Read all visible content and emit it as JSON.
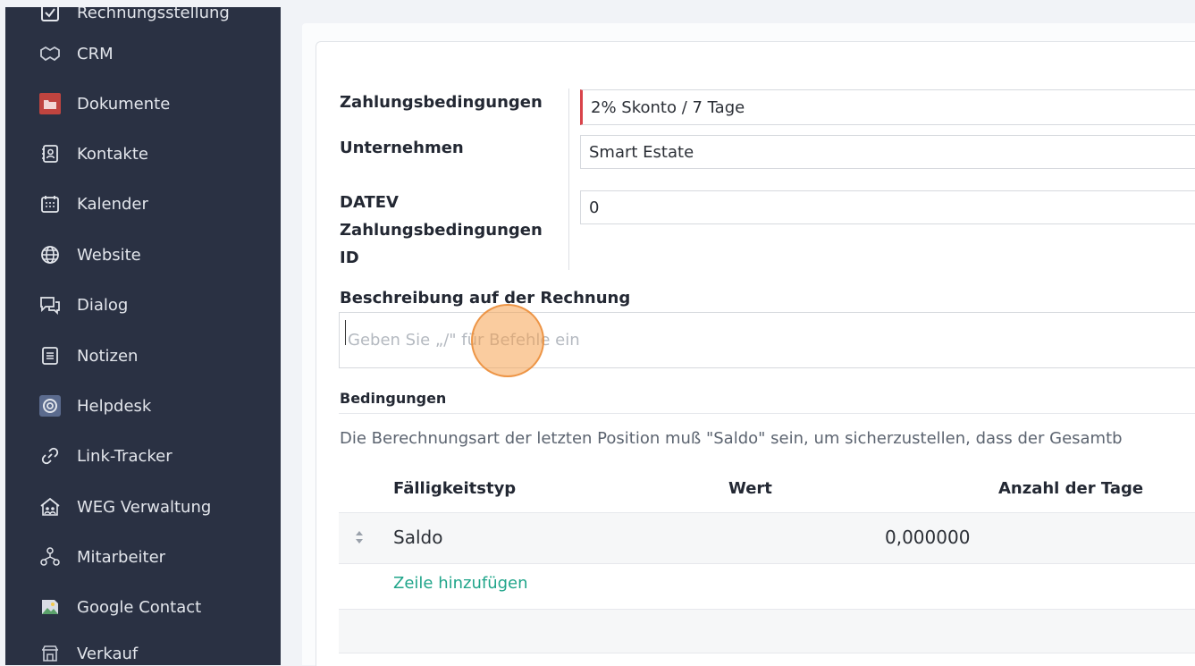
{
  "sidebar": {
    "items": [
      {
        "label": "Rechnungsstellung",
        "icon": "checkbox-icon"
      },
      {
        "label": "CRM",
        "icon": "handshake-icon"
      },
      {
        "label": "Dokumente",
        "icon": "folder-icon"
      },
      {
        "label": "Kontakte",
        "icon": "contact-book-icon"
      },
      {
        "label": "Kalender",
        "icon": "calendar-icon"
      },
      {
        "label": "Website",
        "icon": "globe-icon"
      },
      {
        "label": "Dialog",
        "icon": "chat-icon"
      },
      {
        "label": "Notizen",
        "icon": "note-icon"
      },
      {
        "label": "Helpdesk",
        "icon": "lifebuoy-icon"
      },
      {
        "label": "Link-Tracker",
        "icon": "link-icon"
      },
      {
        "label": "WEG Verwaltung",
        "icon": "house-people-icon"
      },
      {
        "label": "Mitarbeiter",
        "icon": "people-tree-icon"
      },
      {
        "label": "Google Contact",
        "icon": "image-icon"
      },
      {
        "label": "Verkauf",
        "icon": "store-icon"
      }
    ]
  },
  "form": {
    "payment_terms_label": "Zahlungsbedingungen",
    "payment_terms_value": "2% Skonto / 7 Tage",
    "company_label": "Unternehmen",
    "company_value": "Smart Estate",
    "datev_label_1": "DATEV",
    "datev_label_2": "Zahlungsbedingungen",
    "datev_label_3": "ID",
    "datev_value": "0",
    "invoice_description_label": "Beschreibung auf der Rechnung",
    "invoice_description_placeholder": "Geben Sie „/\" für Befehle ein"
  },
  "conditions": {
    "section_label": "Bedingungen",
    "info_text": "Die Berechnungsart der letzten Position muß \"Saldo\" sein, um sicherzustellen, dass der Gesamtb",
    "columns": [
      "Fälligkeitstyp",
      "Wert",
      "Anzahl der Tage"
    ],
    "rows": [
      {
        "type": "Saldo",
        "value": "0,000000",
        "days": ""
      }
    ],
    "add_row_label": "Zeile hinzufügen"
  },
  "colors": {
    "sidebar_bg": "#2a3143",
    "required_marker": "#d9434a",
    "link": "#20a58a",
    "click_indicator": "#f5a250"
  }
}
